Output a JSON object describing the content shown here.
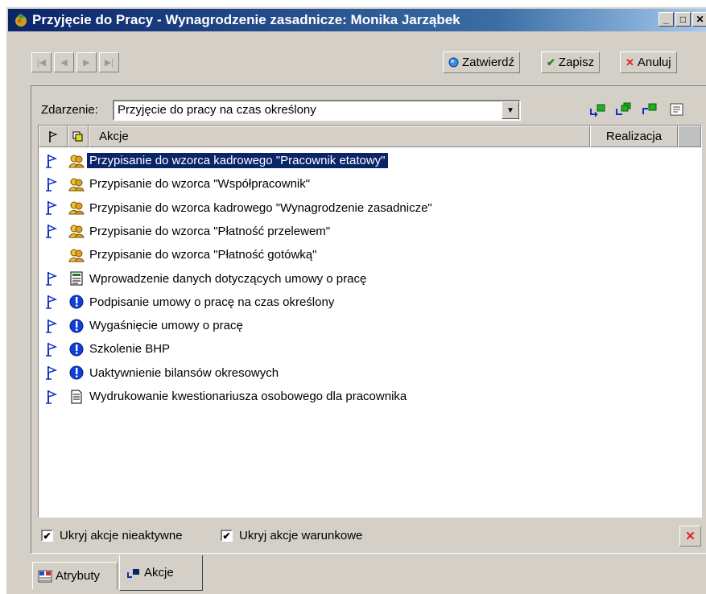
{
  "window": {
    "title": "Przyjęcie do Pracy - Wynagrodzenie zasadnicze: Monika Jarząbek",
    "title_buttons": [
      "_",
      "□",
      "✕"
    ]
  },
  "toolbar": {
    "nav": [
      "|◀",
      "◀",
      "▶",
      "▶|"
    ],
    "confirm_label": "Zatwierdź",
    "save_label": "Zapisz",
    "cancel_label": "Anuluj"
  },
  "event": {
    "label": "Zdarzenie:",
    "value": "Przyjęcie do pracy na czas określony"
  },
  "list": {
    "columns": {
      "actions": "Akcje",
      "realization": "Realizacja"
    },
    "rows": [
      {
        "flag": true,
        "icon": "people-icon",
        "text": "Przypisanie do wzorca kadrowego \"Pracownik etatowy\"",
        "selected": true
      },
      {
        "flag": true,
        "icon": "people-icon",
        "text": "Przypisanie do wzorca \"Współpracownik\"",
        "selected": false
      },
      {
        "flag": true,
        "icon": "people-icon",
        "text": "Przypisanie do wzorca kadrowego \"Wynagrodzenie zasadnicze\"",
        "selected": false
      },
      {
        "flag": true,
        "icon": "people-icon",
        "text": "Przypisanie do wzorca \"Płatność przelewem\"",
        "selected": false
      },
      {
        "flag": false,
        "icon": "people-icon",
        "text": "Przypisanie do wzorca \"Płatność gotówką\"",
        "selected": false
      },
      {
        "flag": true,
        "icon": "form-icon",
        "text": "Wprowadzenie danych dotyczących umowy o pracę",
        "selected": false
      },
      {
        "flag": true,
        "icon": "info-icon",
        "text": "Podpisanie umowy o pracę na czas określony",
        "selected": false
      },
      {
        "flag": true,
        "icon": "info-icon",
        "text": "Wygaśnięcie umowy o pracę",
        "selected": false
      },
      {
        "flag": true,
        "icon": "info-icon",
        "text": "Szkolenie BHP",
        "selected": false
      },
      {
        "flag": true,
        "icon": "info-icon",
        "text": "Uaktywnienie bilansów okresowych",
        "selected": false
      },
      {
        "flag": true,
        "icon": "document-icon",
        "text": "Wydrukowanie kwestionariusza osobowego dla pracownika",
        "selected": false
      }
    ]
  },
  "options": {
    "hide_inactive_label": "Ukryj akcje nieaktywne",
    "hide_inactive_checked": true,
    "hide_conditional_label": "Ukryj akcje warunkowe",
    "hide_conditional_checked": true
  },
  "tabs": [
    {
      "label": "Atrybuty",
      "active": false
    },
    {
      "label": "Akcje",
      "active": true
    }
  ],
  "colors": {
    "selection": "#0a246a",
    "title_gradient_start": "#0a246a",
    "face": "#d4d0c8",
    "flag": "#1030c0",
    "info": "#1040d8"
  }
}
